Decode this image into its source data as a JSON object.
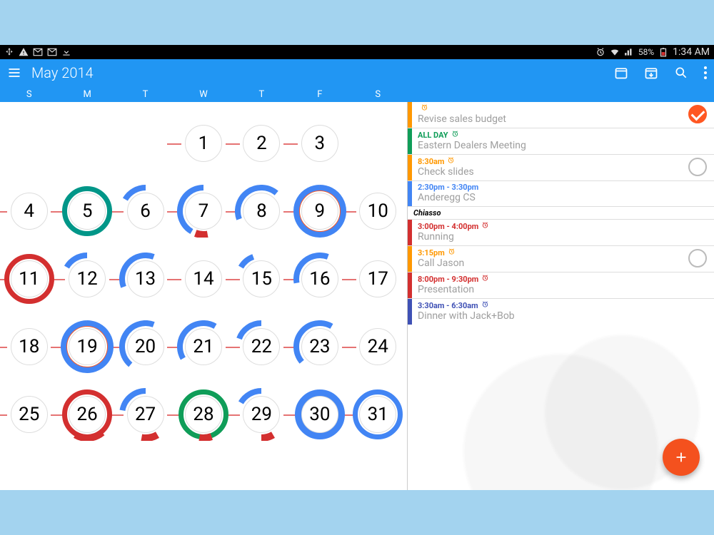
{
  "statusbar": {
    "battery": "58%",
    "time": "1:34 AM"
  },
  "header": {
    "title": "May 2014"
  },
  "dow": [
    "S",
    "M",
    "T",
    "W",
    "T",
    "F",
    "S"
  ],
  "weeks": [
    [
      null,
      null,
      null,
      {
        "d": "1"
      },
      {
        "d": "2"
      },
      {
        "d": "3"
      },
      null
    ],
    [
      {
        "d": "4"
      },
      {
        "d": "5",
        "ring": "teal"
      },
      {
        "d": "6",
        "arcs": [
          [
            "blue",
            300,
            60
          ]
        ]
      },
      {
        "d": "7",
        "arcs": [
          [
            "blue",
            210,
            150
          ],
          [
            "red",
            170,
            30
          ]
        ]
      },
      {
        "d": "8",
        "arcs": [
          [
            "blue",
            250,
            150
          ]
        ]
      },
      {
        "d": "9",
        "ring": "orange",
        "arcs": [
          [
            "blue",
            0,
            360
          ]
        ]
      },
      {
        "d": "10"
      }
    ],
    [
      {
        "d": "11",
        "ring": "red"
      },
      {
        "d": "12",
        "arcs": [
          [
            "blue",
            300,
            60
          ]
        ]
      },
      {
        "d": "13",
        "arcs": [
          [
            "blue",
            250,
            130
          ]
        ]
      },
      {
        "d": "14"
      },
      {
        "d": "15",
        "arcs": [
          [
            "blue",
            300,
            40
          ]
        ]
      },
      {
        "d": "16",
        "arcs": [
          [
            "blue",
            260,
            120
          ]
        ]
      },
      {
        "d": "17"
      }
    ],
    [
      {
        "d": "18"
      },
      {
        "d": "19",
        "ring": "orange",
        "arcs": [
          [
            "blue",
            0,
            360
          ]
        ]
      },
      {
        "d": "20",
        "arcs": [
          [
            "blue",
            220,
            160
          ]
        ]
      },
      {
        "d": "21",
        "arcs": [
          [
            "blue",
            240,
            150
          ]
        ]
      },
      {
        "d": "22",
        "arcs": [
          [
            "blue",
            290,
            70
          ]
        ]
      },
      {
        "d": "23",
        "arcs": [
          [
            "blue",
            230,
            160
          ]
        ]
      },
      {
        "d": "24"
      }
    ],
    [
      {
        "d": "25"
      },
      {
        "d": "26",
        "ring": "red",
        "arcs": [
          [
            "red",
            140,
            70
          ]
        ]
      },
      {
        "d": "27",
        "arcs": [
          [
            "blue",
            280,
            80
          ],
          [
            "red",
            150,
            40
          ]
        ]
      },
      {
        "d": "28",
        "ring": "green",
        "arcs": [
          [
            "red",
            160,
            30
          ]
        ]
      },
      {
        "d": "29",
        "arcs": [
          [
            "blue",
            300,
            60
          ],
          [
            "red",
            150,
            30
          ]
        ]
      },
      {
        "d": "30",
        "ring": "blue",
        "ringwide": true
      },
      {
        "d": "31",
        "ring": "blue"
      }
    ]
  ],
  "section_label": "Chiasso",
  "events": [
    {
      "color": "#ff9800",
      "time": "",
      "title": "Revise sales budget",
      "alarm": true,
      "check": "done",
      "timecolor": "#ff9800"
    },
    {
      "color": "#0f9d58",
      "time": "ALL DAY",
      "title": "Eastern Dealers Meeting",
      "alarm": true,
      "timecolor": "#0f9d58"
    },
    {
      "color": "#ff9800",
      "time": "8:30am",
      "title": "Check slides",
      "alarm": true,
      "check": "open",
      "timecolor": "#ff9800"
    },
    {
      "color": "#4285f4",
      "time": "2:30pm - 3:30pm",
      "title": "Anderegg CS",
      "timecolor": "#4285f4"
    }
  ],
  "events2": [
    {
      "color": "#d32f2f",
      "time": "3:00pm - 4:00pm",
      "title": "Running",
      "alarm": true,
      "timecolor": "#d32f2f"
    },
    {
      "color": "#ff9800",
      "time": "3:15pm",
      "title": "Call Jason",
      "alarm": true,
      "check": "open",
      "timecolor": "#ff9800"
    },
    {
      "color": "#d32f2f",
      "time": "8:00pm - 9:30pm",
      "title": "Presentation",
      "alarm": true,
      "timecolor": "#d32f2f"
    },
    {
      "color": "#3f51b5",
      "time": "3:30am - 6:30am",
      "title": "Dinner with Jack+Bob",
      "alarm": true,
      "timecolor": "#3f51b5"
    }
  ]
}
